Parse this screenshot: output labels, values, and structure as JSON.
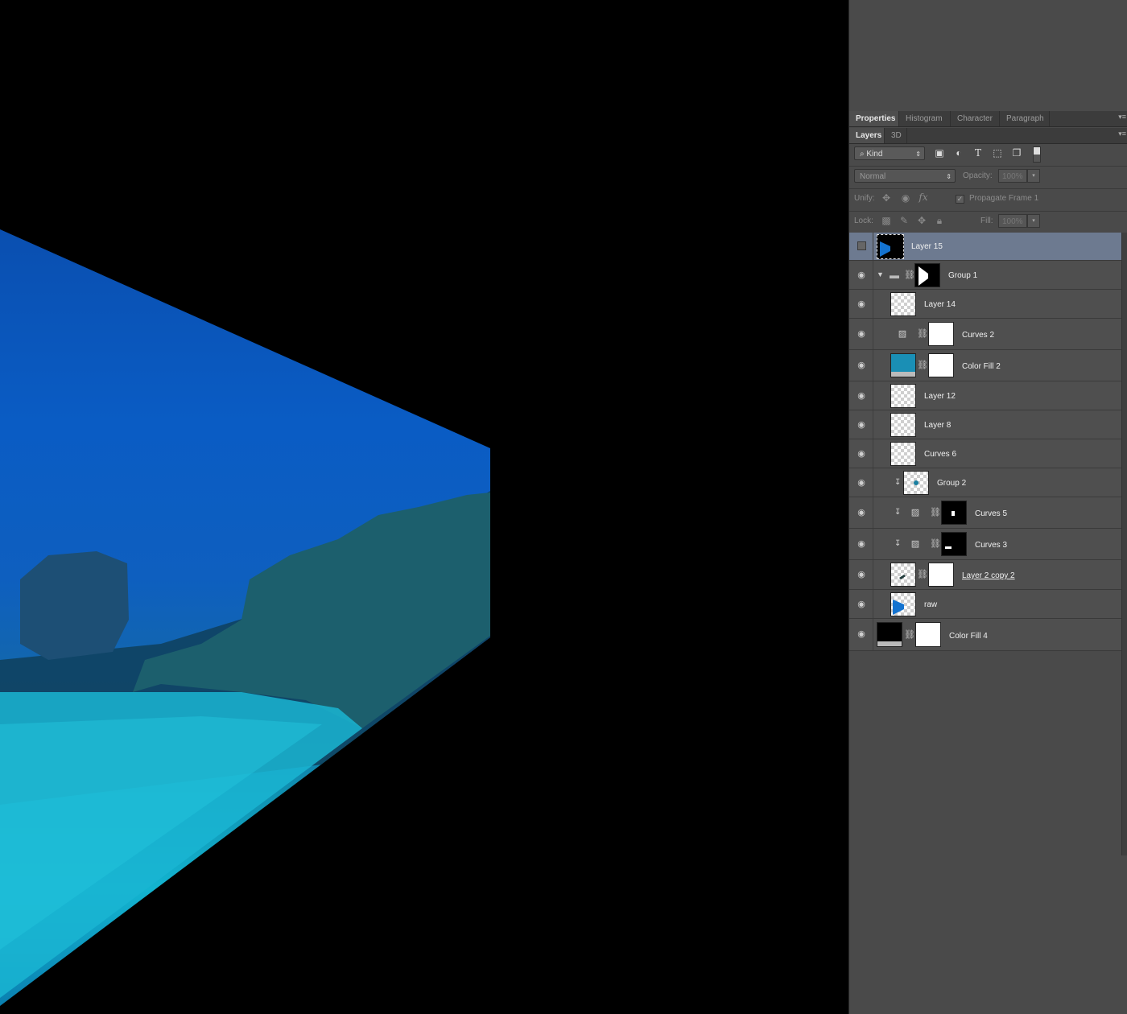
{
  "canvas": {
    "image": "underwater-coral-reef-perspective"
  },
  "panel": {
    "top_tabs": [
      "Properties",
      "Histogram",
      "Character",
      "Paragraph"
    ],
    "layer_tabs": [
      "Layers",
      "3D"
    ],
    "filter": {
      "kind_label": "Kind"
    },
    "blend": {
      "mode": "Normal",
      "opacity_label": "Opacity:",
      "opacity_value": "100%"
    },
    "unify": {
      "label": "Unify:",
      "propagate_label": "Propagate Frame 1"
    },
    "lock": {
      "label": "Lock:",
      "fill_label": "Fill:",
      "fill_value": "100%"
    },
    "layers": [
      {
        "name": "Layer 15",
        "selected": true,
        "visible": false
      },
      {
        "name": "Group 1",
        "type": "group"
      },
      {
        "name": "Layer 14"
      },
      {
        "name": "Curves 2",
        "type": "adjustment"
      },
      {
        "name": "Color Fill 2",
        "type": "fill",
        "color": "#1a8fb5"
      },
      {
        "name": "Layer 12"
      },
      {
        "name": "Layer 8"
      },
      {
        "name": "Curves 6"
      },
      {
        "name": "Group 2",
        "clipped": true
      },
      {
        "name": "Curves 5",
        "type": "adjustment",
        "clipped": true
      },
      {
        "name": "Curves 3",
        "type": "adjustment",
        "clipped": true
      },
      {
        "name": "Layer 2 copy 2",
        "underlined": true
      },
      {
        "name": "raw"
      },
      {
        "name": "Color Fill 4",
        "type": "fill",
        "color": "#000000"
      }
    ]
  },
  "colors": {
    "panel_bg": "#4a4a4a",
    "selected_row": "#6d7a90"
  }
}
